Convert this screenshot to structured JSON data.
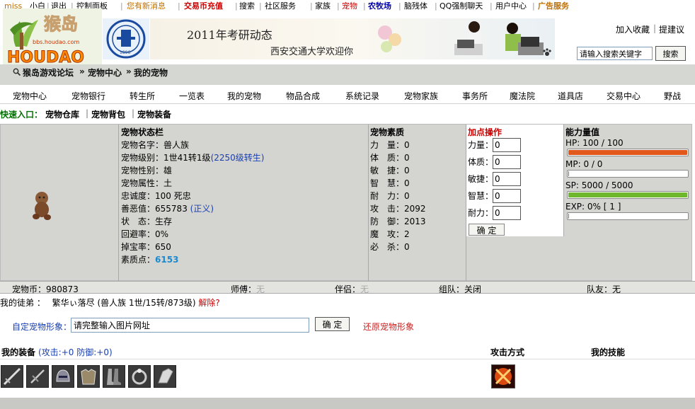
{
  "topnav": {
    "items": [
      "miss",
      "小白",
      "退出",
      "控制面板",
      "您有新消息",
      "交易币充值",
      "搜索",
      "社区服务",
      "家族",
      "宠物",
      "农牧场",
      "脑残体",
      "QQ强制聊天",
      "用户中心",
      "广告服务"
    ],
    "colors": {
      "user": "#c07000",
      "alert": "#c07000",
      "red": "#cc0000",
      "blue": "#0000aa",
      "green": "#007000"
    }
  },
  "logo": {
    "text": "猴岛",
    "latin": "HOUDAO",
    "url_text": "bbs.houdao.com"
  },
  "banner": {
    "title": "2011年考研动态",
    "subtitle": "西安交通大学欢迎你"
  },
  "header": {
    "bookmark": "加入收藏",
    "feedback": "提建议",
    "search_placeholder": "请输入搜索关键字",
    "search_button": "搜索"
  },
  "breadcrumb": [
    "猴岛游戏论坛",
    "宠物中心",
    "我的宠物"
  ],
  "menu": [
    "宠物中心",
    "宠物银行",
    "转生所",
    "一览表",
    "我的宠物",
    "物品合成",
    "系统记录",
    "宠物家族",
    "事务所",
    "魔法院",
    "道具店",
    "交易中心",
    "野战"
  ],
  "quick": {
    "label": "快速入口：",
    "links": [
      "宠物仓库",
      "宠物背包",
      "宠物装备"
    ]
  },
  "status": {
    "title": "宠物状态栏",
    "name_label": "宠物名字：",
    "name": "兽人族",
    "level_label": "宠物级别：",
    "level": "1世41转1级",
    "level_link": "(2250级转生)",
    "gender_label": "宠物性别：",
    "gender": "雄",
    "attr_label": "宠物属性：",
    "attr": "土",
    "loyalty_label": "忠诚度：",
    "loyalty": "100 死忠",
    "karma_label": "善恶值：",
    "karma": "655783",
    "karma_tag": "(正义)",
    "state_label": "状　态：",
    "state": "生存",
    "dodge_label": "回避率：",
    "dodge": "0%",
    "drop_label": "掉宝率：",
    "drop": "650",
    "points_label": "素质点：",
    "points": "6153"
  },
  "quality": {
    "title": "宠物素质",
    "rows": [
      {
        "label": "力　量：",
        "value": "0"
      },
      {
        "label": "体　质：",
        "value": "0"
      },
      {
        "label": "敏　捷：",
        "value": "0"
      },
      {
        "label": "智　慧：",
        "value": "0"
      },
      {
        "label": "耐　力：",
        "value": "0"
      },
      {
        "label": "攻　击：",
        "value": "2092"
      },
      {
        "label": "防　御：",
        "value": "2013"
      },
      {
        "label": "魔　攻：",
        "value": "2"
      },
      {
        "label": "必　杀：",
        "value": "0"
      }
    ]
  },
  "addpoint": {
    "title": "加点操作",
    "rows": [
      {
        "label": "力量：",
        "value": "0"
      },
      {
        "label": "体质：",
        "value": "0"
      },
      {
        "label": "敏捷：",
        "value": "0"
      },
      {
        "label": "智慧：",
        "value": "0"
      },
      {
        "label": "耐力：",
        "value": "0"
      }
    ],
    "confirm": "确 定"
  },
  "ability": {
    "title": "能力量值",
    "hp": {
      "text": "HP:  100 / 100",
      "fraction": 1.0,
      "color": "#e2581a"
    },
    "mp": {
      "text": "MP:  0 / 0",
      "fraction": 0.0,
      "color": "#4a7fd0"
    },
    "sp": {
      "text": "SP:  5000 / 5000",
      "fraction": 1.0,
      "color": "#6fb82e"
    },
    "exp": {
      "text": "EXP:  0% [ 1 ]",
      "fraction": 0.0,
      "color": "#e2a81a"
    }
  },
  "stats": {
    "coin_label": "宠物币：",
    "coin": "980873",
    "master_label": "师傅：",
    "master": "无",
    "partner_label": "伴侣：",
    "partner": "无",
    "team_label": "组队：",
    "team": "关闭",
    "teammate_label": "队友：",
    "teammate": "无"
  },
  "apprentice": {
    "label": "我的徒弟 ：",
    "value": "繁华ぃ落尽 (兽人族 1世/15转/873级)",
    "action": "解除?"
  },
  "custom": {
    "label": "自定宠物形象：",
    "value": "请完整输入图片网址",
    "confirm": "确 定",
    "restore": "还原宠物形象"
  },
  "equipment": {
    "title": "我的装备",
    "stats": "(攻击:+0 防御:+0)",
    "attack_title": "攻击方式",
    "skills_title": "我的技能",
    "items": [
      "sword-icon",
      "dagger-icon",
      "helmet-icon",
      "armor-icon",
      "shield-icon",
      "boots-icon",
      "ring-icon",
      "gauntlet-icon"
    ]
  }
}
